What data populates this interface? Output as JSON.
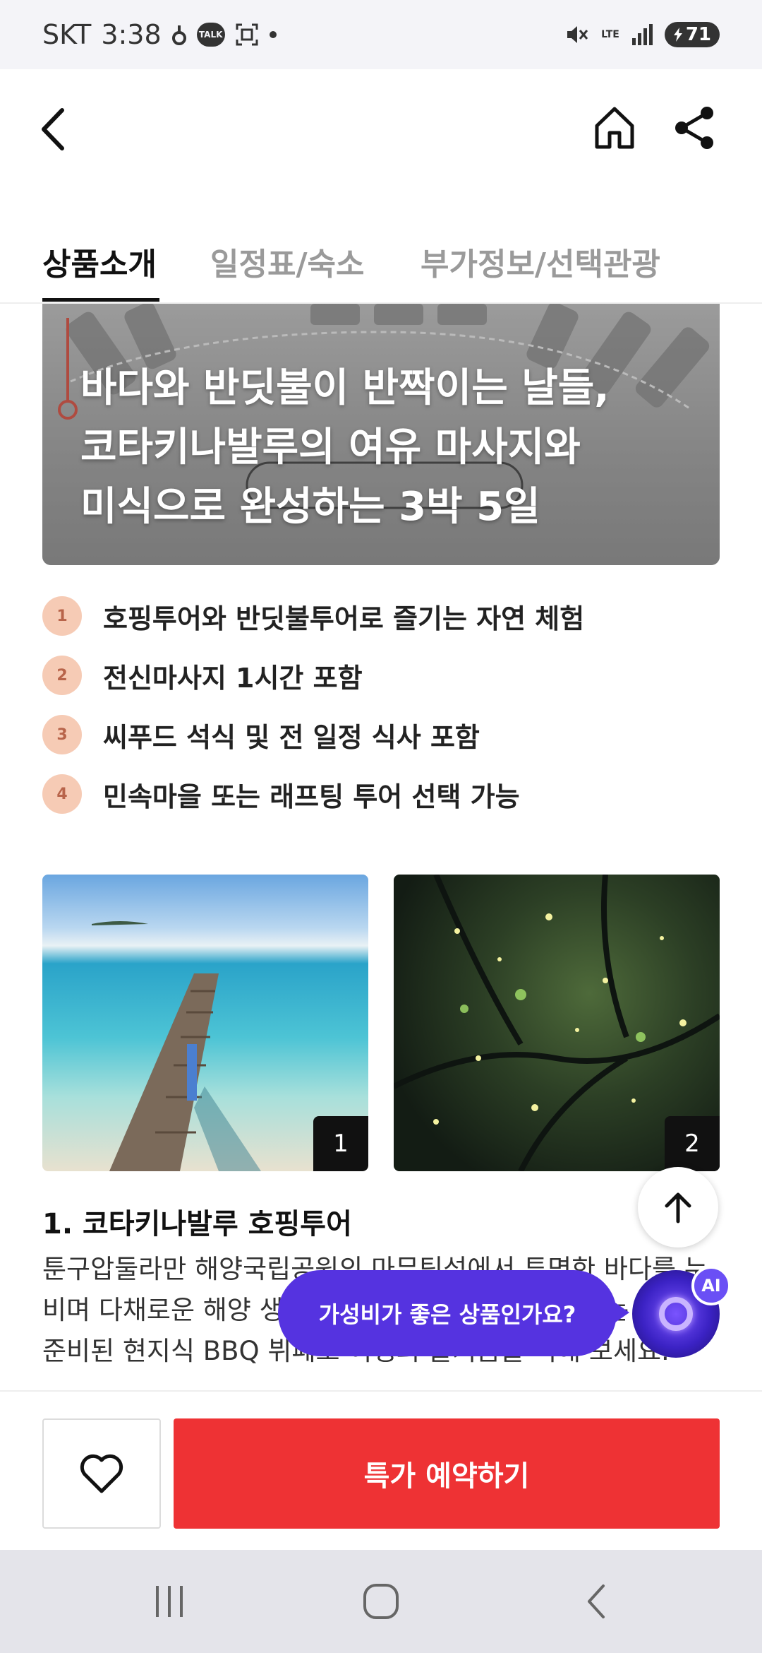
{
  "status_bar": {
    "carrier": "SKT",
    "time": "3:38",
    "talk_badge": "TALK",
    "network": "LTE",
    "battery": "71",
    "icons": [
      "signal-icon",
      "mute-icon",
      "wifi-icon",
      "battery-icon"
    ]
  },
  "header": {
    "icons": [
      "back-icon",
      "home-icon",
      "share-icon"
    ]
  },
  "tabs": [
    {
      "label": "상품소개",
      "active": true
    },
    {
      "label": "일정표/숙소",
      "active": false
    },
    {
      "label": "부가정보/선택관광",
      "active": false
    }
  ],
  "hero": {
    "line1": "바다와 반딧불이 반짝이는 날들,",
    "line2": "코타키나발루의 여유 마사지와",
    "line3": "미식으로 완성하는 3박 5일"
  },
  "highlights": [
    {
      "icon": "hand-one-icon",
      "text": "호핑투어와 반딧불투어로 즐기는 자연 체험"
    },
    {
      "icon": "hand-two-icon",
      "text": "전신마사지 1시간 포함"
    },
    {
      "icon": "hand-three-icon",
      "text": "씨푸드 석식 및 전 일정 식사 포함"
    },
    {
      "icon": "hand-four-icon",
      "text": "민속마을 또는 래프팅 투어 선택 가능"
    }
  ],
  "photos": [
    {
      "badge": "1"
    },
    {
      "badge": "2"
    }
  ],
  "section": {
    "title": "1. 코타키나발루 호핑투어",
    "body": "툰구압둘라만 해양국립공원의 마무틱섬에서 투명한 바다를 누비며 다채로운 해양 생물을 만나보세요. 물놀이 후에는 정성껏 준비된 현지식 BBQ 뷔페로 여행의 즐거움을 더해 보세요."
  },
  "ai_prompt": {
    "bubble_text": "가성비가 좋은 상품인가요?",
    "badge": "AI"
  },
  "bottom_bar": {
    "book_label": "특가 예약하기"
  },
  "colors": {
    "accent": "#ee3234",
    "ai_purple": "#5533e0",
    "tab_active": "#111111",
    "tab_inactive": "#9a9a9a"
  }
}
